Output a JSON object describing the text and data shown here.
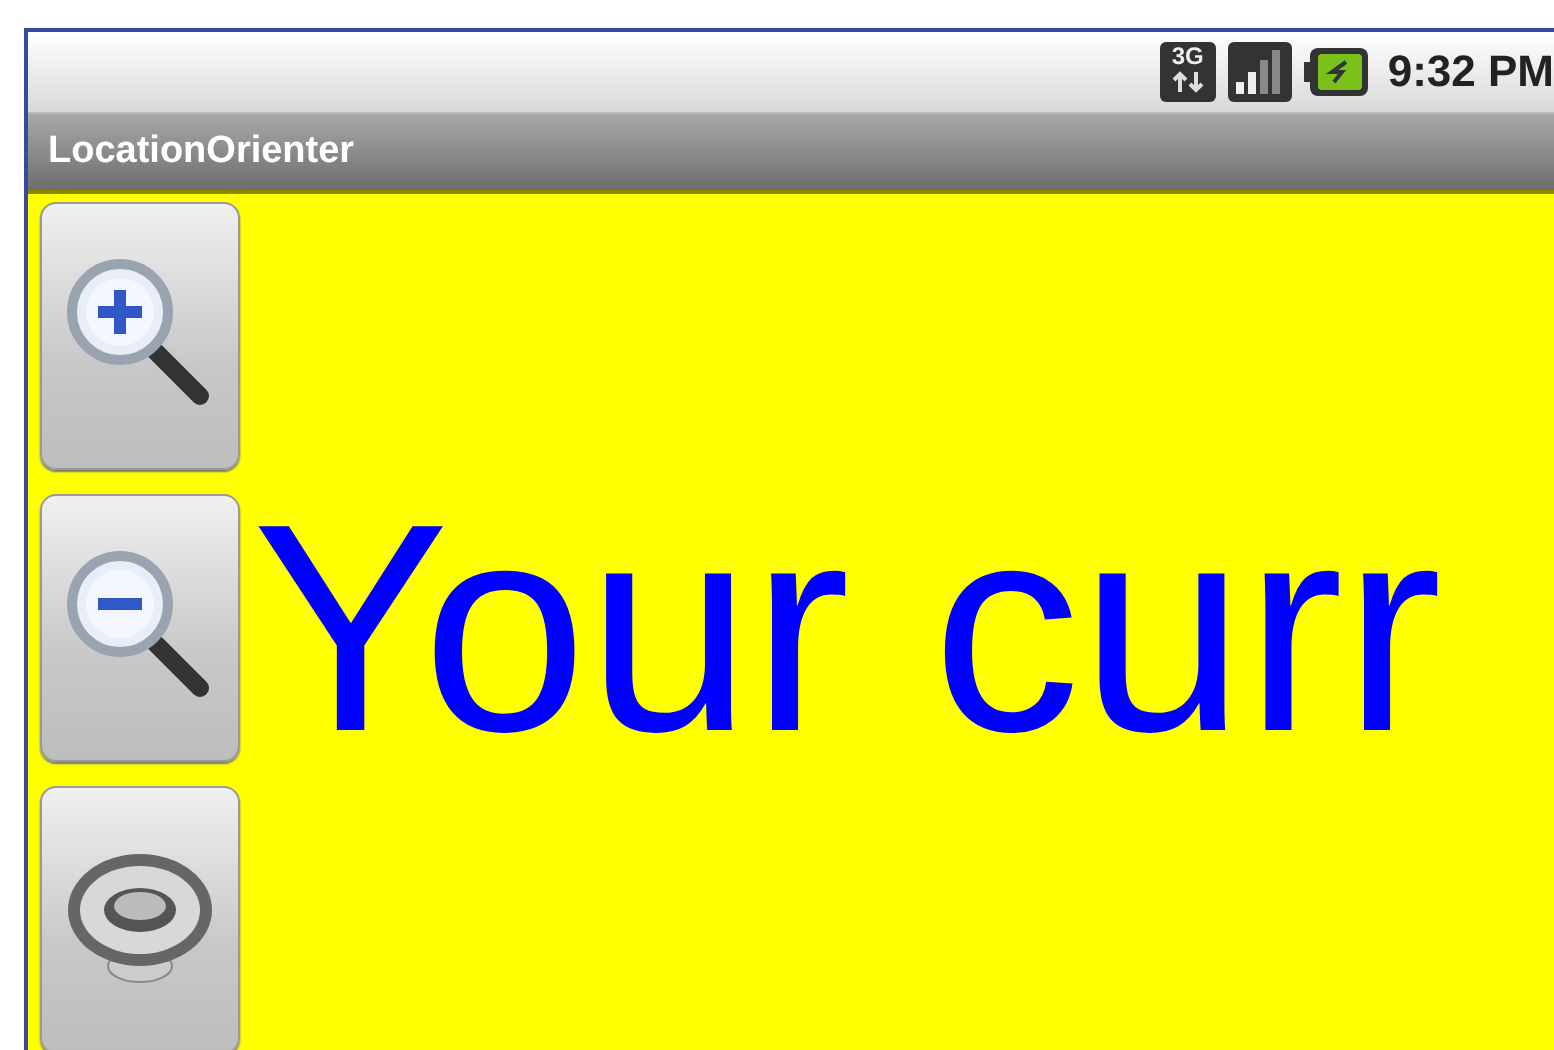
{
  "status_bar": {
    "network": "3G",
    "time": "9:32 PM"
  },
  "title_bar": {
    "title": "LocationOrienter"
  },
  "side_buttons": [
    {
      "kind": "zoom_in"
    },
    {
      "kind": "zoom_out"
    },
    {
      "kind": "sound"
    }
  ],
  "message": "Your curr"
}
